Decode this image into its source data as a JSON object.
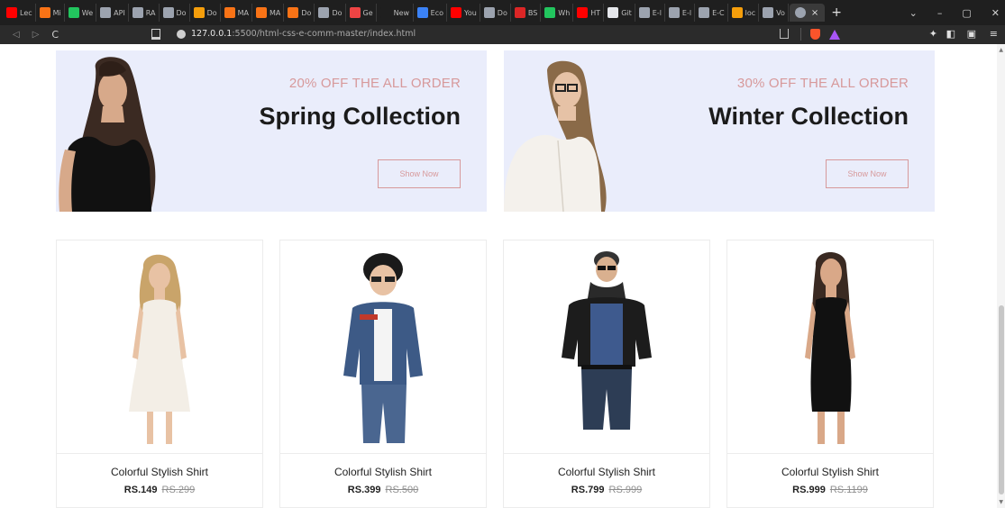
{
  "browser": {
    "tabs": [
      {
        "label": "Lec",
        "color": "#ff0000"
      },
      {
        "label": "Mi",
        "color": "#f97316"
      },
      {
        "label": "We",
        "color": "#22c55e"
      },
      {
        "label": "API",
        "color": "#9ca3af"
      },
      {
        "label": "RA",
        "color": "#9ca3af"
      },
      {
        "label": "Do",
        "color": "#9ca3af"
      },
      {
        "label": "Do",
        "color": "#f59e0b"
      },
      {
        "label": "MA",
        "color": "#f97316"
      },
      {
        "label": "MA",
        "color": "#f97316"
      },
      {
        "label": "Do",
        "color": "#f97316"
      },
      {
        "label": "Do",
        "color": "#9ca3af"
      },
      {
        "label": "Ge",
        "color": "#ef4444"
      },
      {
        "label": "New Ta",
        "color": "#1f1f1f"
      },
      {
        "label": "Eco",
        "color": "#3b82f6"
      },
      {
        "label": "You",
        "color": "#ff0000"
      },
      {
        "label": "Do",
        "color": "#9ca3af"
      },
      {
        "label": "BS",
        "color": "#dc2626"
      },
      {
        "label": "Wh",
        "color": "#22c55e"
      },
      {
        "label": "HT",
        "color": "#ff0000"
      },
      {
        "label": "Git",
        "color": "#e5e7eb"
      },
      {
        "label": "E-l",
        "color": "#9ca3af"
      },
      {
        "label": "E-l",
        "color": "#9ca3af"
      },
      {
        "label": "E-C",
        "color": "#9ca3af"
      },
      {
        "label": "loc",
        "color": "#f59e0b"
      },
      {
        "label": "Vo",
        "color": "#9ca3af"
      }
    ],
    "active_tab_close": "×",
    "new_tab": "+",
    "window_controls": {
      "dropdown": "⌄",
      "minimize": "–",
      "maximize": "▢",
      "close": "✕"
    },
    "url_host": "127.0.0.1",
    "url_rest": ":5500/html-css-e-comm-master/index.html",
    "nav": {
      "back": "◁",
      "forward": "▷",
      "reload": "C"
    },
    "extensions": {
      "puzzle": "✦",
      "sidebar": "◧",
      "wallet": "▣",
      "menu": "≡"
    }
  },
  "banners": [
    {
      "offer": "20% OFF THE ALL ORDER",
      "title": "Spring Collection",
      "button": "Show Now"
    },
    {
      "offer": "30% OFF THE ALL ORDER",
      "title": "Winter Collection",
      "button": "Show Now"
    }
  ],
  "products": [
    {
      "name": "Colorful Stylish Shirt",
      "price": "RS.149",
      "old_price": "RS.299"
    },
    {
      "name": "Colorful Stylish Shirt",
      "price": "RS.399",
      "old_price": "RS.500"
    },
    {
      "name": "Colorful Stylish Shirt",
      "price": "RS.799",
      "old_price": "RS.999"
    },
    {
      "name": "Colorful Stylish Shirt",
      "price": "RS.999",
      "old_price": "RS.1199"
    }
  ],
  "colors": {
    "accent": "#d7999b",
    "banner_bg": "#eaedfb"
  }
}
